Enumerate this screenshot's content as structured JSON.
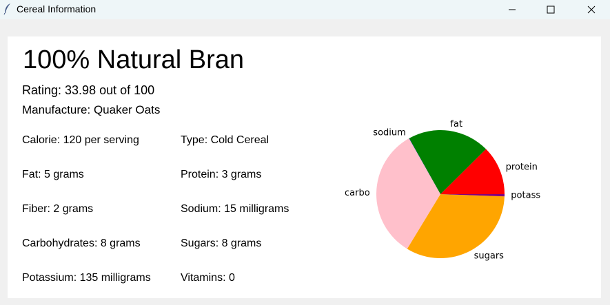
{
  "window": {
    "title": "Cereal Information",
    "icon": "feather-icon",
    "controls": [
      "minimize-icon",
      "maximize-icon",
      "close-icon"
    ]
  },
  "cereal": {
    "name": "100% Natural Bran",
    "rating": "Rating: 33.98 out of 100",
    "manufacturer": "Manufacture: Quaker Oats"
  },
  "facts": {
    "calorie": "Calorie: 120 per serving",
    "type": "Type: Cold Cereal",
    "fat": "Fat: 5 grams",
    "protein": "Protein: 3 grams",
    "fiber": "Fiber: 2 grams",
    "sodium": "Sodium: 15 milligrams",
    "carbohydrates": "Carbohydrates: 8 grams",
    "sugars": "Sugars: 8 grams",
    "potassium": "Potassium: 135 milligrams",
    "vitamins": "Vitamins: 0"
  },
  "chart_data": {
    "type": "pie",
    "categories": [
      "protein",
      "fat",
      "sodium",
      "carbo",
      "sugars",
      "potass"
    ],
    "values": [
      3,
      5,
      0.015,
      8,
      8,
      0.135
    ],
    "colors": [
      "#ff0000",
      "#008000",
      "#0000ff",
      "#ffc0cb",
      "#ffa500",
      "#800080"
    ],
    "start_angle_deg": 0,
    "direction": "counterclockwise"
  }
}
